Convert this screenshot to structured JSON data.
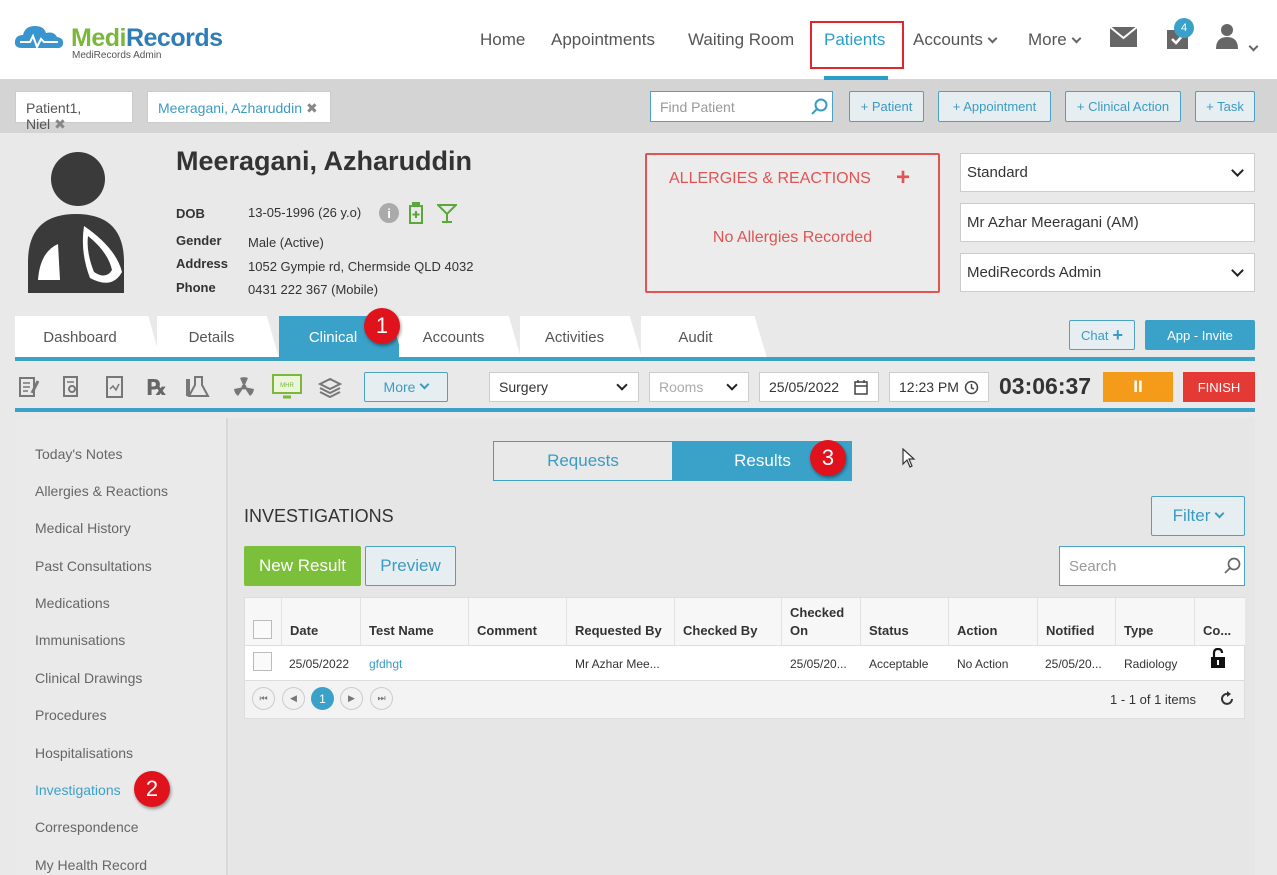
{
  "app": {
    "name_part1": "Medi",
    "name_part2": "Records",
    "subtitle": "MediRecords Admin"
  },
  "nav": {
    "home": "Home",
    "appointments": "Appointments",
    "waiting_room": "Waiting Room",
    "patients": "Patients",
    "accounts": "Accounts",
    "more": "More",
    "task_count": "4"
  },
  "open_patients": [
    "Patient1, Niel",
    "Meeragani, Azharuddin"
  ],
  "find_placeholder": "Find Patient",
  "quick_actions": [
    "+ Patient",
    "+ Appointment",
    "+ Clinical Action",
    "+ Task"
  ],
  "patient": {
    "name": "Meeragani, Azharuddin",
    "dob_label": "DOB",
    "dob": "13-05-1996 (26 y.o)",
    "gender_label": "Gender",
    "gender": "Male (Active)",
    "address_label": "Address",
    "address": "1052 Gympie rd, Chermside QLD 4032",
    "phone_label": "Phone",
    "phone": "0431 222 367 (Mobile)"
  },
  "allergies": {
    "title": "ALLERGIES & REACTIONS",
    "add": "+",
    "empty": "No Allergies Recorded"
  },
  "selects": {
    "type": "Standard",
    "practitioner": "Mr Azhar Meeragani (AM)",
    "location": "MediRecords Admin"
  },
  "tabs": [
    "Dashboard",
    "Details",
    "Clinical",
    "Accounts",
    "Activities",
    "Audit"
  ],
  "chat_label": "Chat",
  "app_invite_label": "App - Invite",
  "badges": {
    "b1": "1",
    "b2": "2",
    "b3": "3"
  },
  "toolbar": {
    "more": "More",
    "surgery": "Surgery",
    "rooms": "Rooms",
    "date": "25/05/2022",
    "time": "12:23 PM",
    "timer": "03:06:37",
    "pause": "II",
    "finish": "FINISH",
    "mhr": "MHR"
  },
  "side_nav": [
    "Today's Notes",
    "Allergies & Reactions",
    "Medical History",
    "Past Consultations",
    "Medications",
    "Immunisations",
    "Clinical Drawings",
    "Procedures",
    "Hospitalisations",
    "Investigations",
    "Correspondence",
    "My Health Record"
  ],
  "toggle": {
    "requests": "Requests",
    "results": "Results"
  },
  "section": {
    "title": "INVESTIGATIONS",
    "filter": "Filter",
    "new_result": "New Result",
    "preview": "Preview",
    "search_placeholder": "Search"
  },
  "grid": {
    "columns": [
      "Date",
      "Test Name",
      "Comment",
      "Requested By",
      "Checked By",
      "Checked On",
      "Status",
      "Action",
      "Notified",
      "Type",
      "Co..."
    ],
    "checked_on_line1": "Checked",
    "checked_on_line2": "On",
    "row": {
      "date": "25/05/2022",
      "test_name": "gfdhgt",
      "comment": "",
      "requested_by": "Mr Azhar Mee...",
      "checked_by": "",
      "checked_on": "25/05/20...",
      "status": "Acceptable",
      "action": "No Action",
      "notified": "25/05/20...",
      "type": "Radiology"
    },
    "page": "1",
    "summary": "1 - 1 of 1 items"
  }
}
